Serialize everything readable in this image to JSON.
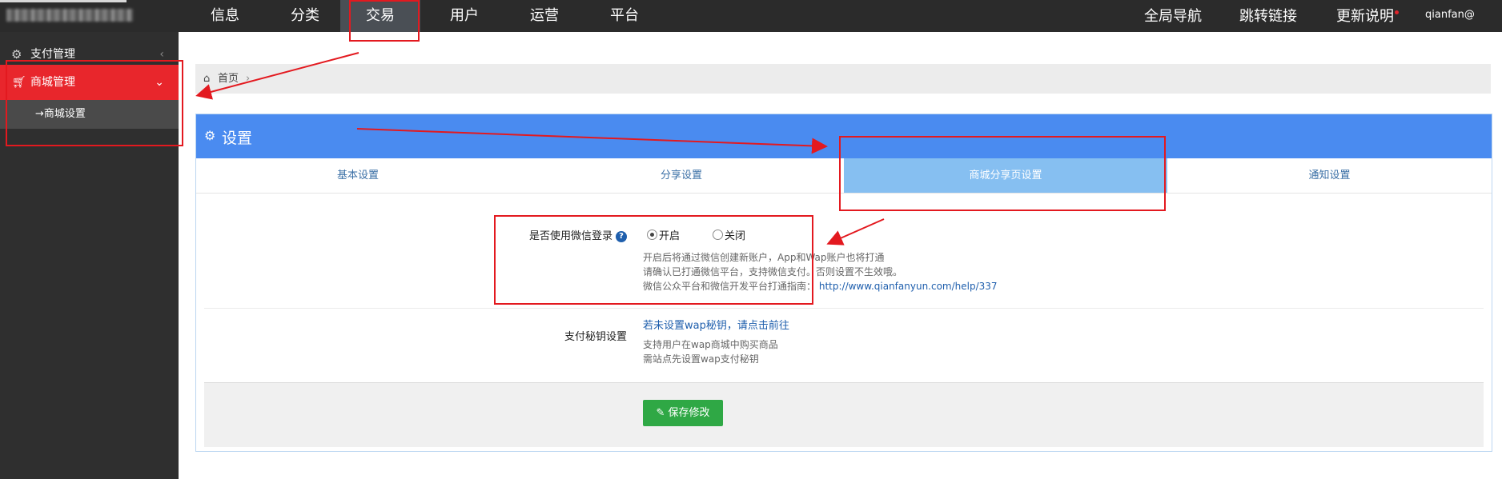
{
  "top_nav": {
    "items": [
      {
        "label": "信息"
      },
      {
        "label": "分类"
      },
      {
        "label": "交易"
      },
      {
        "label": "用户"
      },
      {
        "label": "运营"
      },
      {
        "label": "平台"
      }
    ],
    "right_links": [
      {
        "label": "全局导航"
      },
      {
        "label": "跳转链接"
      },
      {
        "label": "更新说明"
      }
    ],
    "user": "qianfan@"
  },
  "sidebar": {
    "group1": {
      "label": "支付管理",
      "icon": "gears-icon"
    },
    "group2": {
      "label": "商城管理",
      "icon": "cart-icon"
    },
    "sub_item": {
      "label": "商城设置",
      "prefix": "→"
    }
  },
  "breadcrumb": {
    "home": "首页",
    "separator": "›"
  },
  "panel": {
    "title": "设置",
    "tabs": [
      {
        "label": "基本设置"
      },
      {
        "label": "分享设置"
      },
      {
        "label": "商城分享页设置"
      },
      {
        "label": "通知设置"
      }
    ]
  },
  "form": {
    "wechat_login": {
      "label": "是否使用微信登录",
      "help": "?",
      "options": [
        {
          "label": "开启",
          "selected": true
        },
        {
          "label": "关闭",
          "selected": false
        }
      ],
      "hint1": "开启后将通过微信创建新账户，App和Wap账户也将打通",
      "hint2": "请确认已打通微信平台，支持微信支付。否则设置不生效哦。",
      "hint3_prefix": "微信公众平台和微信开发平台打通指南：",
      "hint3_link": "http://www.qianfanyun.com/help/337"
    },
    "pay_secret": {
      "label": "支付秘钥设置",
      "link": "若未设置wap秘钥，请点击前往",
      "hint1": "支持用户在wap商城中购买商品",
      "hint2": "需站点先设置wap支付秘钥"
    },
    "save_button": "保存修改"
  },
  "colors": {
    "top_bar": "#2b2b2b",
    "sidebar": "#2f2f2f",
    "active_menu": "#e8262c",
    "panel_header": "#4a8bf0",
    "active_tab": "#86bff1",
    "save_button": "#2fa845",
    "annotation": "#e3191f"
  }
}
